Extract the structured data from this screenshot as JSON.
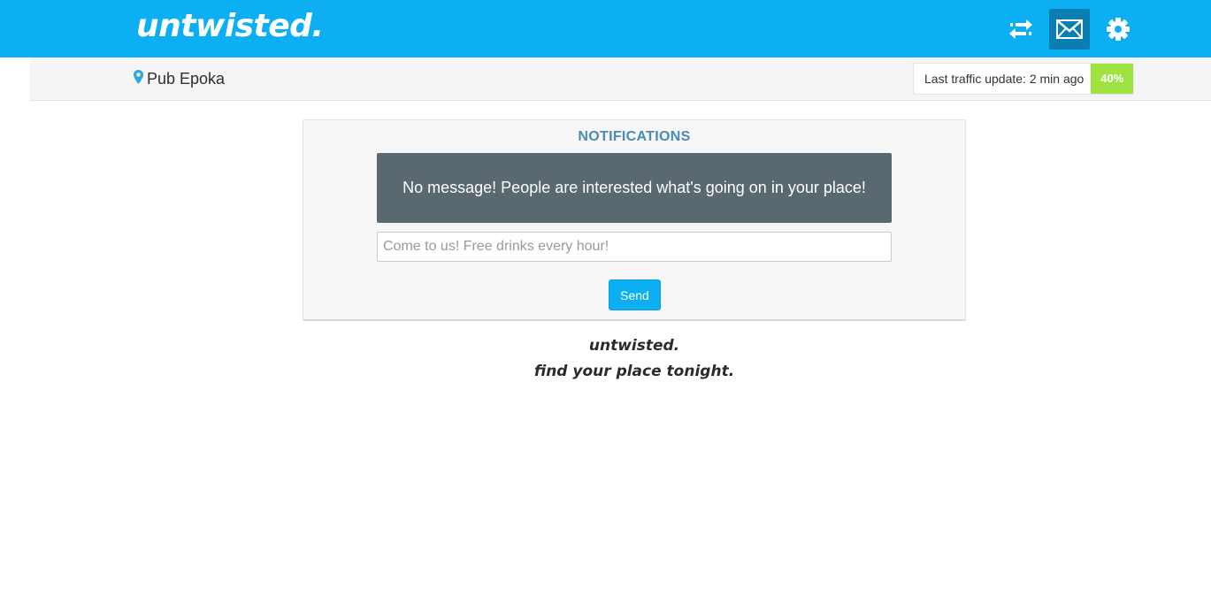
{
  "app": {
    "logo": "untwisted.",
    "brand_color": "#0cb0f2"
  },
  "nav": {
    "icons": [
      {
        "name": "swap-arrows-icon",
        "active": false
      },
      {
        "name": "mail-icon",
        "active": true
      },
      {
        "name": "gear-icon",
        "active": false
      }
    ]
  },
  "location": {
    "icon": "map-pin-icon",
    "name": "Pub Epoka"
  },
  "traffic": {
    "label": "Last traffic update: 2 min ago",
    "percent": "40%",
    "badge_color": "#9ee33f"
  },
  "notifications": {
    "title": "NOTIFICATIONS",
    "empty_message": "No message! People are interested what's going on in your place!",
    "input_placeholder": "Come to us! Free drinks every hour!",
    "input_value": "",
    "send_label": "Send"
  },
  "footer": {
    "brand": "untwisted.",
    "tagline": "find your place tonight."
  }
}
